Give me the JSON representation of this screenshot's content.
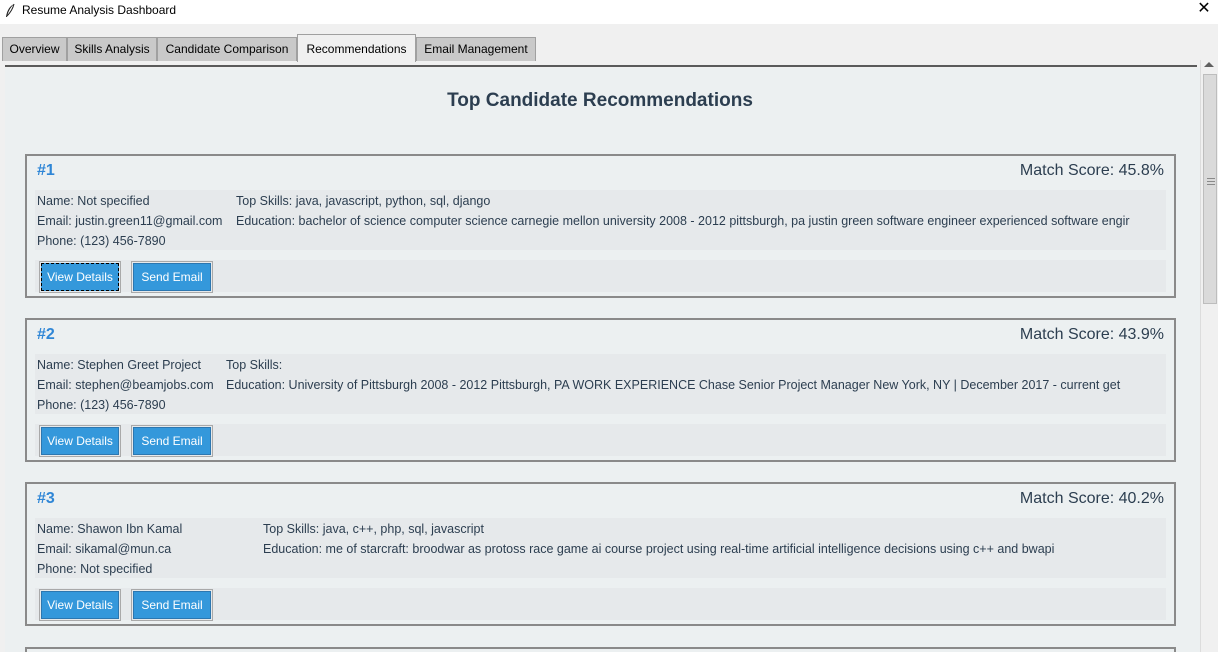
{
  "window": {
    "title": "Resume Analysis Dashboard",
    "close_glyph": "✕"
  },
  "tabs": [
    {
      "label": "Overview",
      "active": false
    },
    {
      "label": "Skills Analysis",
      "active": false
    },
    {
      "label": "Candidate Comparison",
      "active": false
    },
    {
      "label": "Recommendations",
      "active": true
    },
    {
      "label": "Email Management",
      "active": false
    }
  ],
  "page": {
    "title": "Top Candidate Recommendations"
  },
  "candidates": [
    {
      "rank": "#1",
      "match_score": "Match Score: 45.8%",
      "name": "Name: Not specified",
      "top_skills": "Top Skills: java, javascript, python, sql, django",
      "email": "Email: justin.green11@gmail.com",
      "education": "Education: bachelor of science computer science carnegie mellon university 2008 - 2012 pittsburgh, pa justin green software engineer experienced software engir",
      "phone": "Phone: (123) 456-7890",
      "view_label": "View Details",
      "email_label": "Send Email"
    },
    {
      "rank": "#2",
      "match_score": "Match Score: 43.9%",
      "name": "Name: Stephen Greet Project",
      "top_skills": "Top Skills:",
      "email": "Email: stephen@beamjobs.com",
      "education": "Education: University of Pittsburgh 2008 - 2012 Pittsburgh, PA WORK EXPERIENCE Chase Senior Project Manager New York, NY | December 2017 - current get",
      "phone": "Phone: (123) 456-7890",
      "view_label": "View Details",
      "email_label": "Send Email"
    },
    {
      "rank": "#3",
      "match_score": "Match Score: 40.2%",
      "name": "Name: Shawon Ibn Kamal",
      "top_skills": "Top Skills: java, c++, php, sql, javascript",
      "email": "Email: sikamal@mun.ca",
      "education": "Education: me of starcraft: broodwar as protoss race game ai course project using real-time artificial intelligence decisions using c++ and bwapi",
      "phone": "Phone: Not specified",
      "view_label": "View Details",
      "email_label": "Send Email"
    }
  ],
  "colors": {
    "accent": "#3498db",
    "rank": "#2f86d6",
    "text": "#2c3e50",
    "background": "#ecf0f1"
  }
}
